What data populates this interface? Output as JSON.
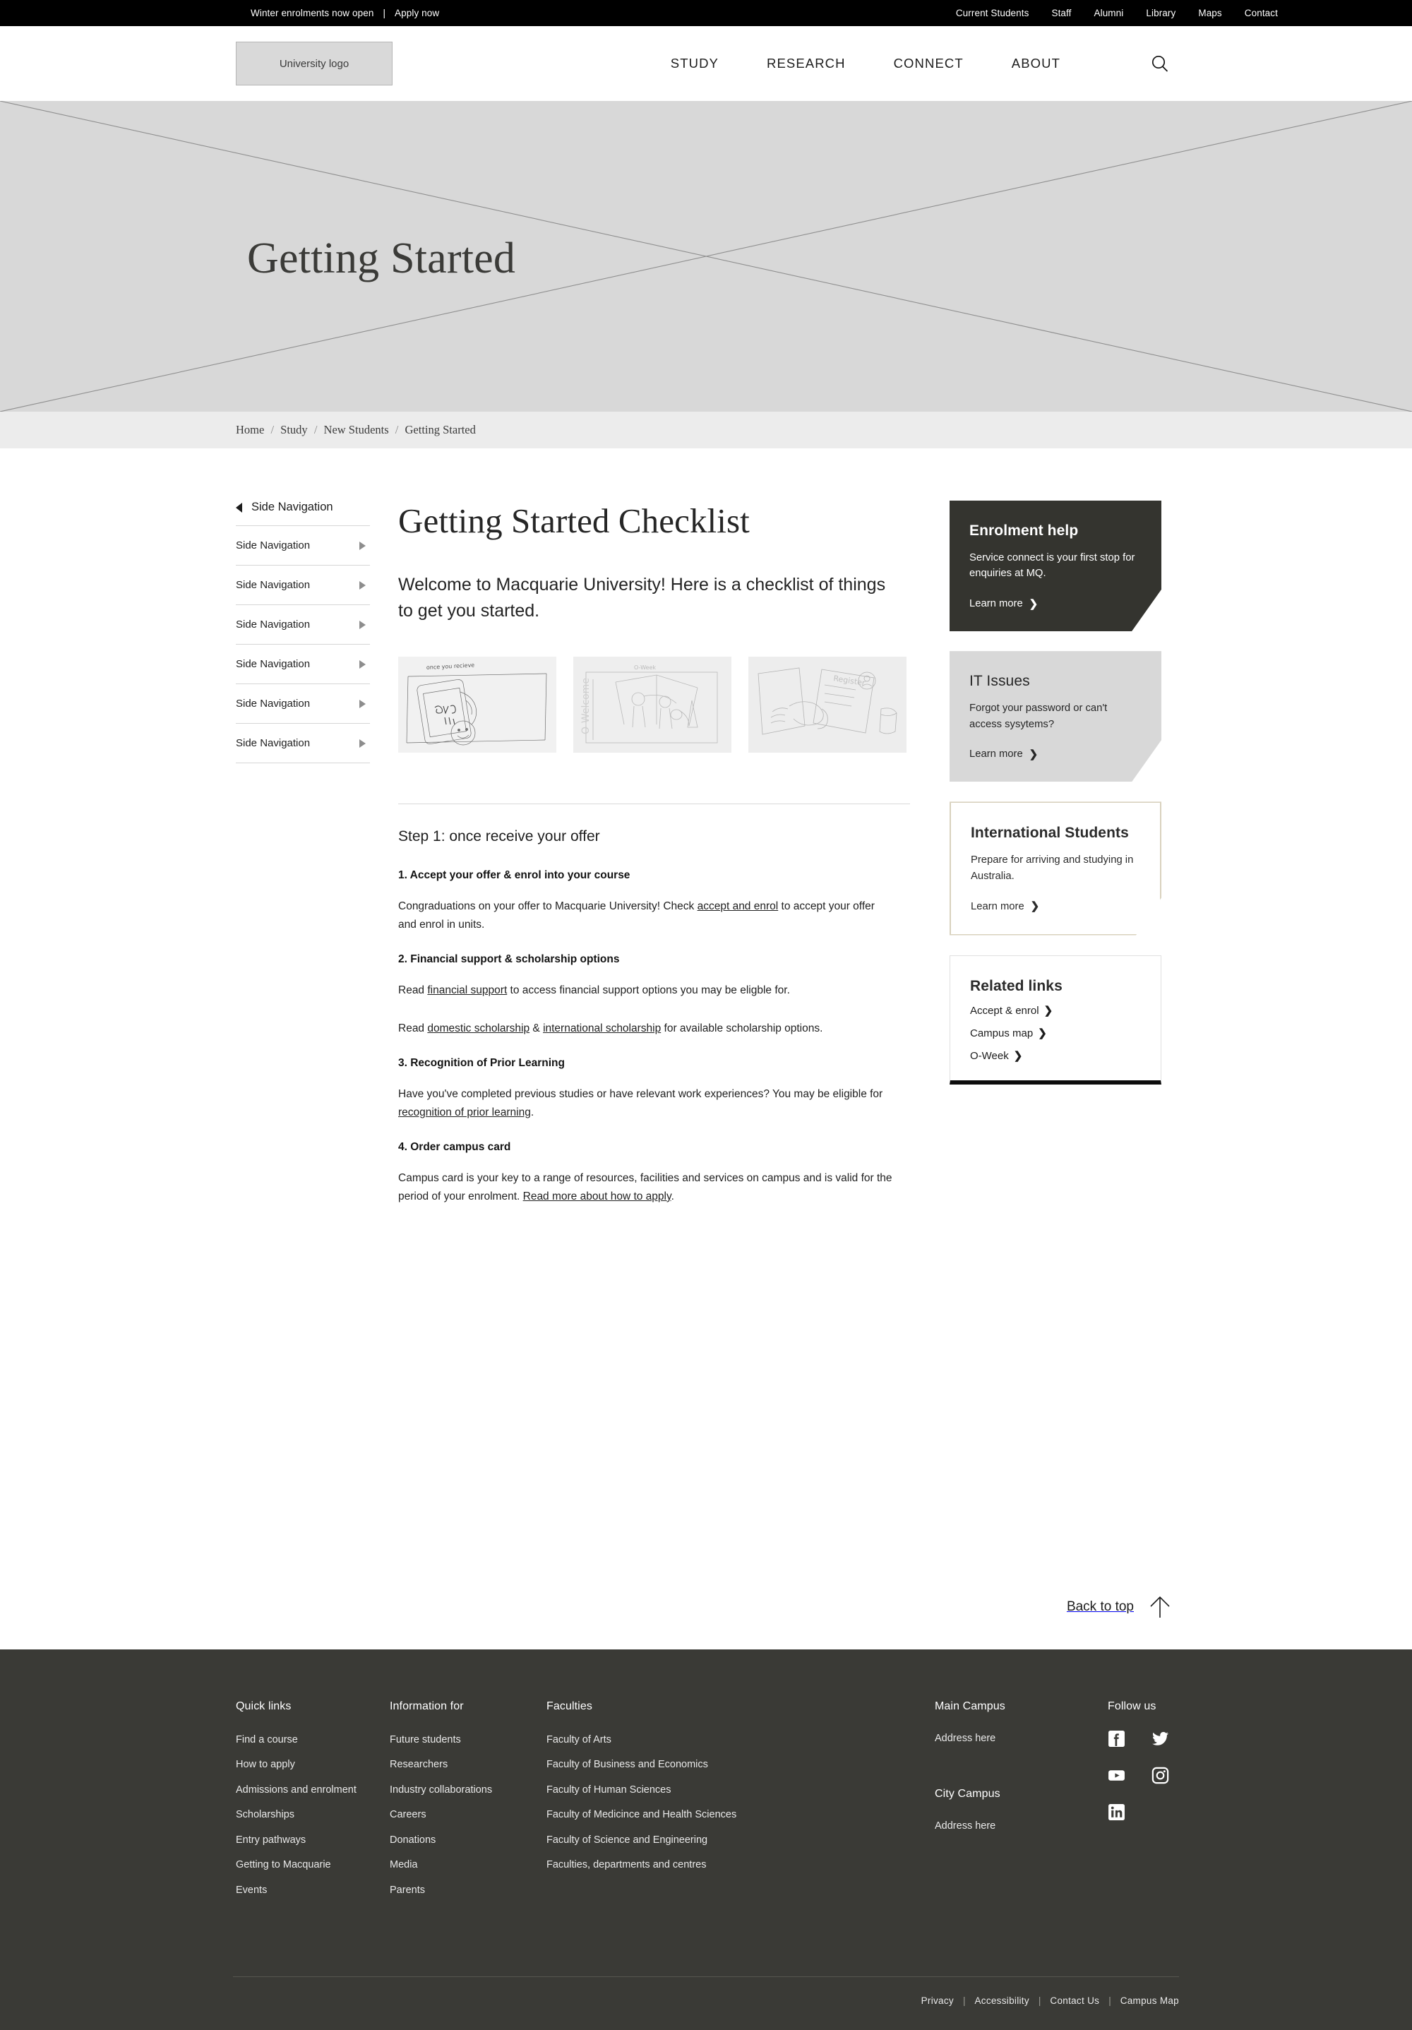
{
  "topbar": {
    "promo": "Winter enrolments now open",
    "separator": "|",
    "promo_cta": "Apply now",
    "links": [
      "Current Students",
      "Staff",
      "Alumni",
      "Library",
      "Maps",
      "Contact"
    ]
  },
  "header": {
    "logo_label": "University logo",
    "nav": [
      "STUDY",
      "RESEARCH",
      "CONNECT",
      "ABOUT"
    ],
    "search_icon": "search-icon"
  },
  "hero": {
    "title": "Getting Started"
  },
  "breadcrumb": {
    "items": [
      "Home",
      "Study",
      "New Students",
      "Getting Started"
    ],
    "separator": "/"
  },
  "sidenav": {
    "header": "Side Navigation",
    "back_icon": "triangle-left-icon",
    "items": [
      "Side Navigation",
      "Side Navigation",
      "Side Navigation",
      "Side Navigation",
      "Side Navigation",
      "Side Navigation"
    ]
  },
  "main": {
    "title": "Getting Started Checklist",
    "lede": "Welcome to Macquarie University! Here is a checklist of things to get you started.",
    "thumbnails": [
      {
        "alt": "sketch-phone-youre-in"
      },
      {
        "alt": "sketch-o-week-welcome"
      },
      {
        "alt": "sketch-register-form"
      }
    ],
    "step_title": "Step 1: once receive your offer",
    "sections": [
      {
        "heading": "1. Accept your offer & enrol into your course",
        "body_before": "Congraduations on your offer to Macquarie University! Check ",
        "link": "accept and enrol",
        "body_after": " to accept your offer and enrol in units."
      },
      {
        "heading": "2. Financial support & scholarship options",
        "p1_before": "Read ",
        "p1_link": "financial support",
        "p1_after": " to access financial support options you may be eligble for.",
        "p2_before": "Read ",
        "p2_link1": "domestic scholarship",
        "p2_mid": " & ",
        "p2_link2": "international scholarship",
        "p2_after": " for available scholarship options."
      },
      {
        "heading": "3. Recognition of Prior Learning",
        "body_before": "Have you've completed previous studies or have relevant work experiences? You may be eligible for ",
        "link": "recognition of prior learning",
        "body_after": "."
      },
      {
        "heading": "4. Order campus card",
        "body_before": "Campus card is your key to a range of resources, facilities and services on campus and is valid for the period of your enrolment. ",
        "link": "Read more about how to apply",
        "body_after": "."
      }
    ]
  },
  "rail": {
    "cards": [
      {
        "title": "Enrolment help",
        "body": "Service connect is your first stop for enquiries at MQ.",
        "cta": "Learn more",
        "style": "dark"
      },
      {
        "title": "IT Issues",
        "body": "Forgot your password or can't access sysytems?",
        "cta": "Learn more",
        "style": "grey"
      },
      {
        "title": "International Students",
        "body": "Prepare for arriving and studying in Australia.",
        "cta": "Learn more",
        "style": "outline"
      }
    ],
    "related": {
      "title": "Related links",
      "links": [
        "Accept & enrol",
        "Campus map",
        "O-Week"
      ]
    }
  },
  "backtop": {
    "label": "Back to top",
    "icon": "arrow-up-icon"
  },
  "footer": {
    "quick": {
      "title": "Quick links",
      "links": [
        "Find a course",
        "How to apply",
        "Admissions and enrolment",
        "Scholarships",
        "Entry pathways",
        "Getting to Macquarie",
        "Events"
      ]
    },
    "info": {
      "title": "Information for",
      "links": [
        "Future students",
        "Researchers",
        "Industry collaborations",
        "Careers",
        "Donations",
        "Media",
        "Parents"
      ]
    },
    "faculties": {
      "title": "Faculties",
      "links": [
        "Faculty of Arts",
        "Faculty of Business and Economics",
        "Faculty of Human Sciences",
        "Faculty of Medicince and Health Sciences",
        "Faculty of Science and Engineering",
        "Faculties, departments and centres"
      ]
    },
    "campus": {
      "main_title": "Main Campus",
      "main_address": "Address here",
      "city_title": "City Campus",
      "city_address": "Address here"
    },
    "social": {
      "title": "Follow us",
      "icons": [
        "facebook-icon",
        "twitter-icon",
        "youtube-icon",
        "instagram-icon",
        "linkedin-icon"
      ]
    },
    "legal": [
      "Privacy",
      "Accessibility",
      "Contact Us",
      "Campus Map"
    ],
    "legal_separator": "|"
  },
  "colors": {
    "topbar_bg": "#000000",
    "hero_bg": "#d8d8d8",
    "breadcrumb_bg": "#ececec",
    "footer_bg": "#3a3a36",
    "card_dark": "#34342f",
    "card_grey": "#d8d8d8",
    "card_outline_border": "#d9d2be"
  }
}
